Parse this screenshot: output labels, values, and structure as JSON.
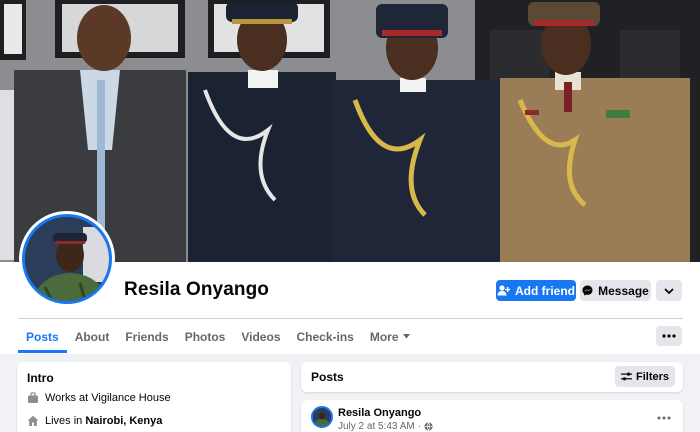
{
  "profile": {
    "name": "Resila Onyango"
  },
  "actions": {
    "add_friend": "Add friend",
    "message": "Message",
    "more_icon": "chevron-down-icon",
    "overflow_icon": "ellipsis-icon"
  },
  "tabs": [
    {
      "label": "Posts",
      "active": true
    },
    {
      "label": "About"
    },
    {
      "label": "Friends"
    },
    {
      "label": "Photos"
    },
    {
      "label": "Videos"
    },
    {
      "label": "Check-ins"
    },
    {
      "label": "More"
    }
  ],
  "intro": {
    "title": "Intro",
    "work_prefix": "Works at ",
    "work_place": "Vigilance House",
    "lives_prefix": "Lives in ",
    "lives_place": "Nairobi, Kenya"
  },
  "posts": {
    "title": "Posts",
    "filters_label": "Filters",
    "first_post": {
      "author": "Resila Onyango",
      "time": "July 2 at 5:43 AM",
      "separator": "·",
      "privacy_icon": "globe-icon"
    }
  },
  "colors": {
    "accent": "#1877f2",
    "background": "#f0f2f5",
    "secondary_button": "#e4e6eb",
    "muted_text": "#65676b"
  }
}
